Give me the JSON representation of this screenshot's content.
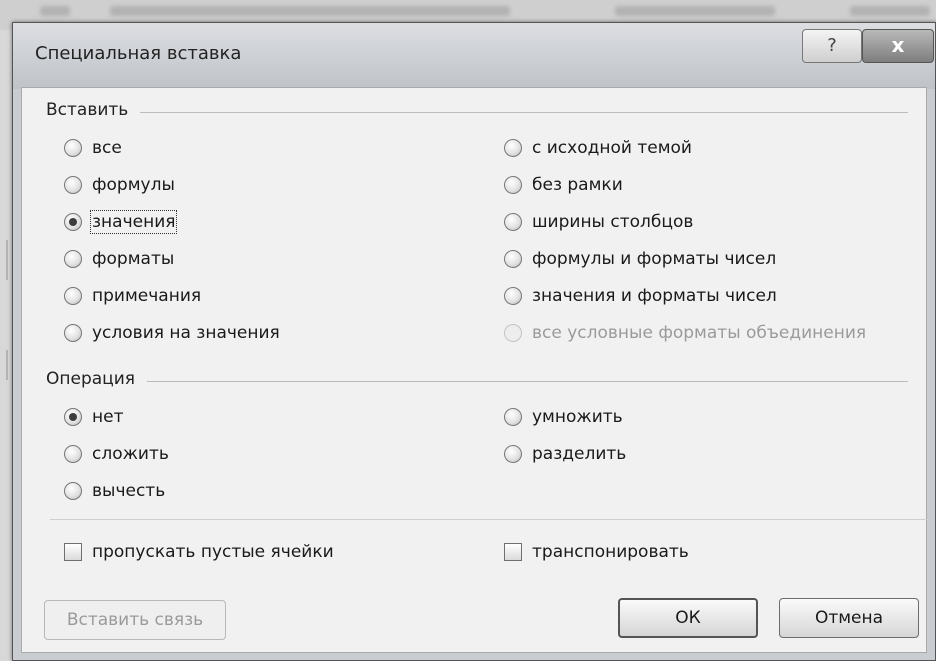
{
  "dialog": {
    "title": "Специальная вставка",
    "help_label": "?",
    "close_label": "x"
  },
  "paste_group": {
    "label": "Вставить",
    "selected": "значения",
    "options_left": [
      "все",
      "формулы",
      "значения",
      "форматы",
      "примечания",
      "условия на значения"
    ],
    "options_right": [
      "с исходной темой",
      "без рамки",
      "ширины столбцов",
      "формулы и форматы чисел",
      "значения и форматы чисел",
      "все условные форматы объединения"
    ],
    "disabled_option": "все условные форматы объединения"
  },
  "operation_group": {
    "label": "Операция",
    "selected": "нет",
    "options_left": [
      "нет",
      "сложить",
      "вычесть"
    ],
    "options_right": [
      "умножить",
      "разделить"
    ]
  },
  "checkboxes": {
    "skip_blanks": "пропускать пустые ячейки",
    "transpose": "транспонировать"
  },
  "buttons": {
    "paste_link": "Вставить связь",
    "ok": "ОК",
    "cancel": "Отмена"
  }
}
